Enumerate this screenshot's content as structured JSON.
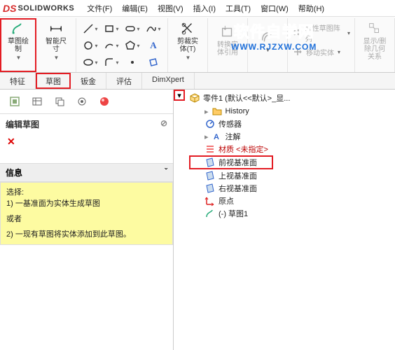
{
  "app": {
    "name": "SOLIDWORKS"
  },
  "menu": [
    "文件(F)",
    "编辑(E)",
    "视图(V)",
    "插入(I)",
    "工具(T)",
    "窗口(W)",
    "帮助(H)"
  ],
  "ribbon": {
    "sketch": "草图绘\n制",
    "smartdim": "智能尺\n寸",
    "trim": "剪裁实\n体(T)",
    "convert": "转换实\n体引用",
    "offset": " ",
    "linear_pattern": "线性草图阵列",
    "move_entity": "移动实体",
    "display_rel": "显示/删\n除几何\n关系"
  },
  "tabs": [
    "特征",
    "草图",
    "钣金",
    "评估",
    "DimXpert"
  ],
  "left": {
    "section": "编辑草图",
    "info_head": "信息",
    "info_l1": "选择:",
    "info_l2": "1) 一基准面为实体生成草图",
    "info_l3": "或者",
    "info_l4": "2) 一现有草图将实体添加到此草图。"
  },
  "tree": {
    "root": "零件1  (默认<<默认>_显...",
    "items": [
      {
        "icon": "history",
        "label": "History"
      },
      {
        "icon": "sensor",
        "label": "传感器"
      },
      {
        "icon": "note",
        "label": "注解"
      },
      {
        "icon": "material",
        "label": "材质 <未指定>"
      },
      {
        "icon": "plane",
        "label": "前视基准面",
        "hl": true
      },
      {
        "icon": "plane",
        "label": "上视基准面"
      },
      {
        "icon": "plane",
        "label": "右视基准面"
      },
      {
        "icon": "origin",
        "label": "原点"
      },
      {
        "icon": "sketch",
        "label": "(-) 草图1"
      }
    ]
  },
  "watermark": {
    "l1": "软件自学网",
    "l2": "WWW.RJZXW.COM"
  }
}
